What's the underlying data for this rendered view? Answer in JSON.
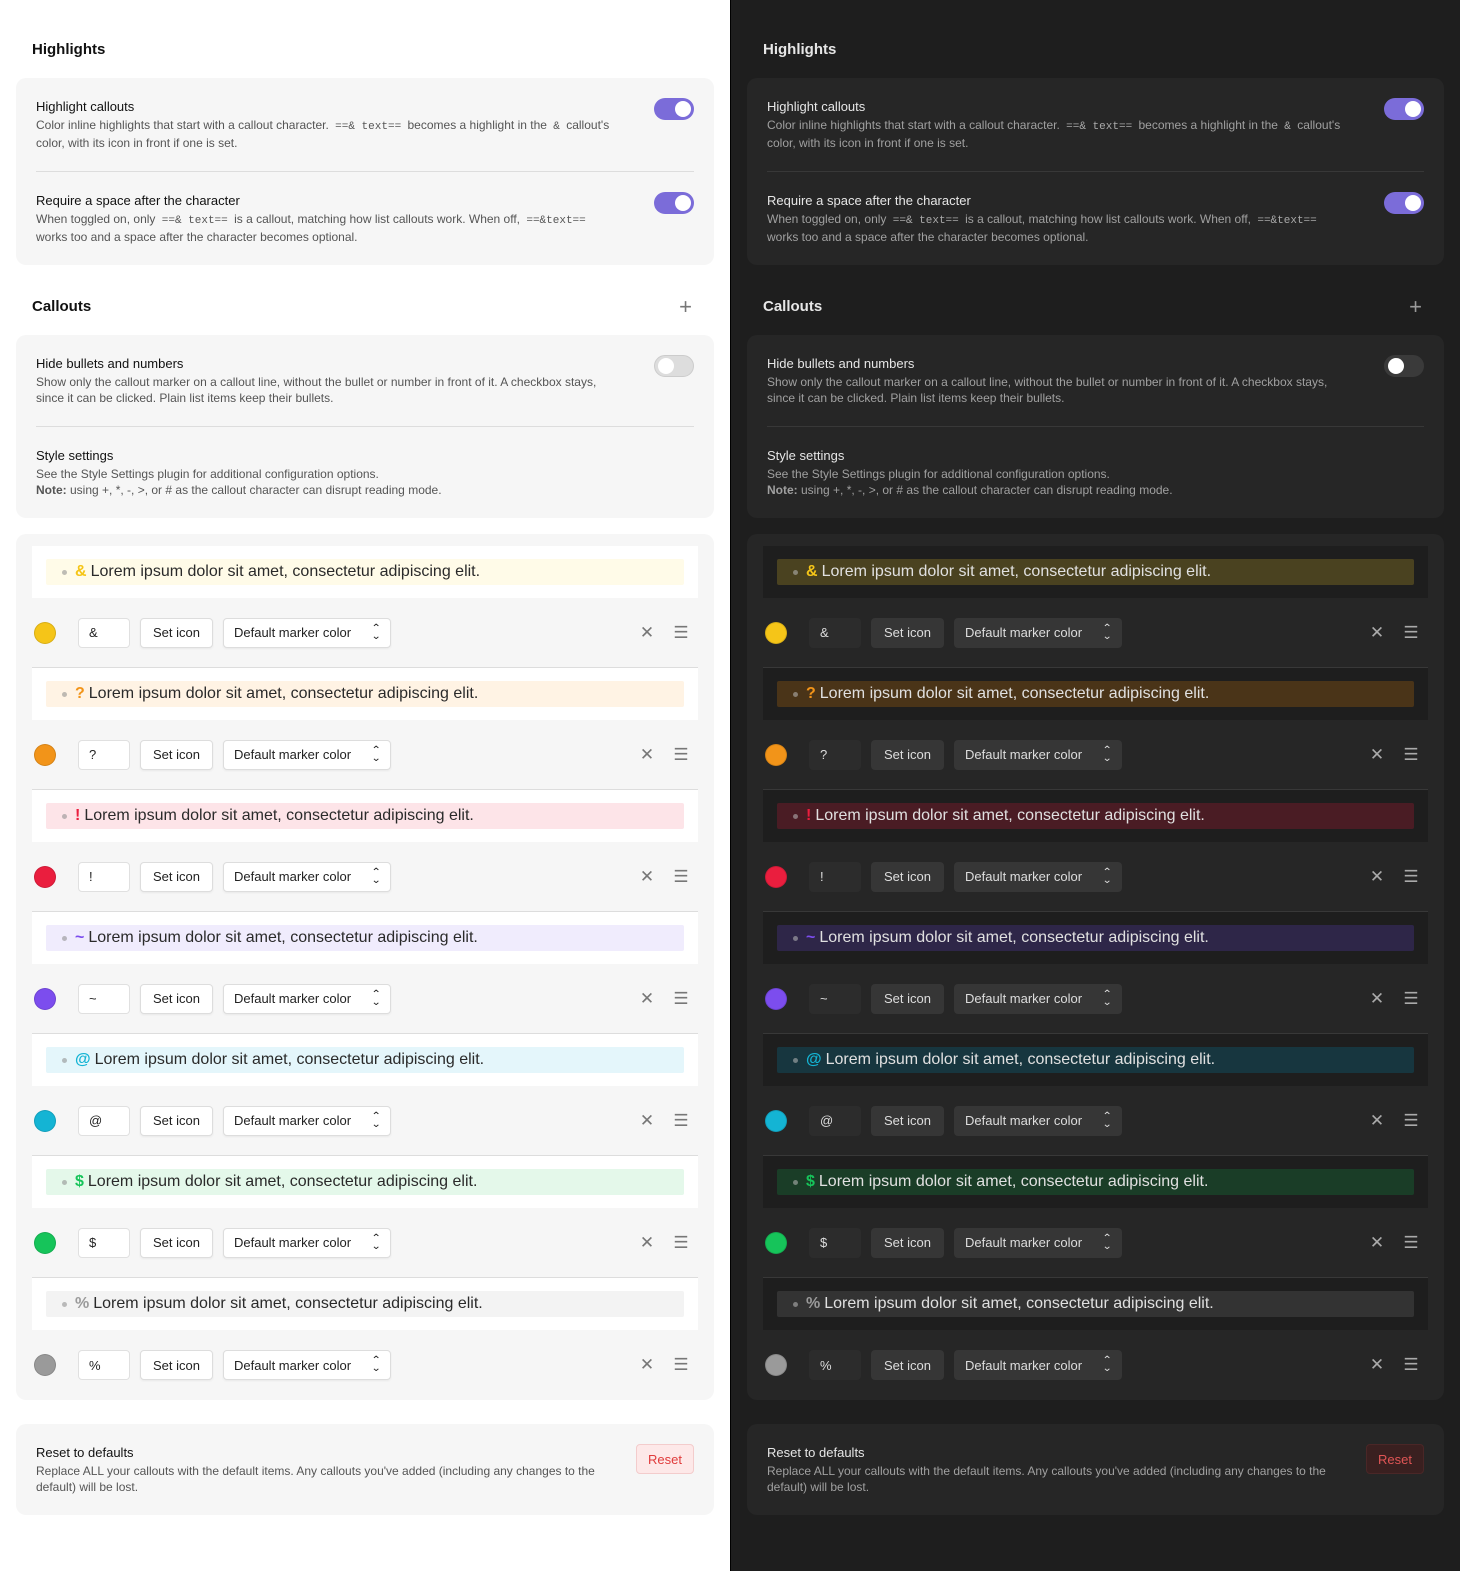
{
  "highlights": {
    "title": "Highlights",
    "settings": [
      {
        "name": "Highlight callouts",
        "desc_pre": "Color inline highlights that start with a callout character. ",
        "code1": "==& text==",
        "desc_mid": " becomes a highlight in the ",
        "code2": "&",
        "desc_post": " callout's color, with its icon in front if one is set.",
        "toggle": true
      },
      {
        "name": "Require a space after the character",
        "desc_pre": "When toggled on, only ",
        "code1": "==& text==",
        "desc_mid": " is a callout, matching how list callouts work. When off, ",
        "code2": "==&text==",
        "desc_post": " works too and a space after the character becomes optional.",
        "toggle": true
      }
    ]
  },
  "callouts": {
    "title": "Callouts",
    "add_icon": "plus-icon",
    "settings": [
      {
        "name": "Hide bullets and numbers",
        "desc": "Show only the callout marker on a callout line, without the bullet or number in front of it. A checkbox stays, since it can be clicked. Plain list items keep their bullets.",
        "toggle": false
      },
      {
        "name": "Style settings",
        "desc": "See the Style Settings plugin for additional configuration options.",
        "note_label": "Note:",
        "note": " using +, *, -, >, or # as the callout character can disrupt reading mode."
      }
    ]
  },
  "items": [
    {
      "char": "&",
      "preview": "Lorem ipsum dolor sit amet, consectetur adipiscing elit.",
      "color": "#f5c518",
      "light_bg": "#fffbe8",
      "dark_bg": "#4a4220",
      "set_icon": "Set icon",
      "marker_color": "Default marker color"
    },
    {
      "char": "?",
      "preview": "Lorem ipsum dolor sit amet, consectetur adipiscing elit.",
      "color": "#f29419",
      "light_bg": "#fff3e4",
      "dark_bg": "#4a3418",
      "set_icon": "Set icon",
      "marker_color": "Default marker color"
    },
    {
      "char": "!",
      "preview": "Lorem ipsum dolor sit amet, consectetur adipiscing elit.",
      "color": "#ea1e3e",
      "light_bg": "#fde4e8",
      "dark_bg": "#4a1c24",
      "set_icon": "Set icon",
      "marker_color": "Default marker color"
    },
    {
      "char": "~",
      "preview": "Lorem ipsum dolor sit amet, consectetur adipiscing elit.",
      "color": "#7c4dee",
      "light_bg": "#f0ecfd",
      "dark_bg": "#2e2648",
      "set_icon": "Set icon",
      "marker_color": "Default marker color"
    },
    {
      "char": "@",
      "preview": "Lorem ipsum dolor sit amet, consectetur adipiscing elit.",
      "color": "#14b4d4",
      "light_bg": "#e4f6fb",
      "dark_bg": "#17363f",
      "set_icon": "Set icon",
      "marker_color": "Default marker color"
    },
    {
      "char": "$",
      "preview": "Lorem ipsum dolor sit amet, consectetur adipiscing elit.",
      "color": "#16c45a",
      "light_bg": "#e4f8ea",
      "dark_bg": "#1a3d27",
      "set_icon": "Set icon",
      "marker_color": "Default marker color"
    },
    {
      "char": "%",
      "preview": "Lorem ipsum dolor sit amet, consectetur adipiscing elit.",
      "color": "#9a9a9a",
      "light_bg": "#f3f3f3",
      "dark_bg": "#333333",
      "set_icon": "Set icon",
      "marker_color": "Default marker color"
    }
  ],
  "reset": {
    "name": "Reset to defaults",
    "desc": "Replace ALL your callouts with the default items. Any callouts you've added (including any changes to the default) will be lost.",
    "button": "Reset"
  },
  "icons": {
    "remove": "close-icon",
    "drag": "drag-handle-icon",
    "select": "chevron-updown-icon"
  },
  "accent": "#7b6cd9"
}
